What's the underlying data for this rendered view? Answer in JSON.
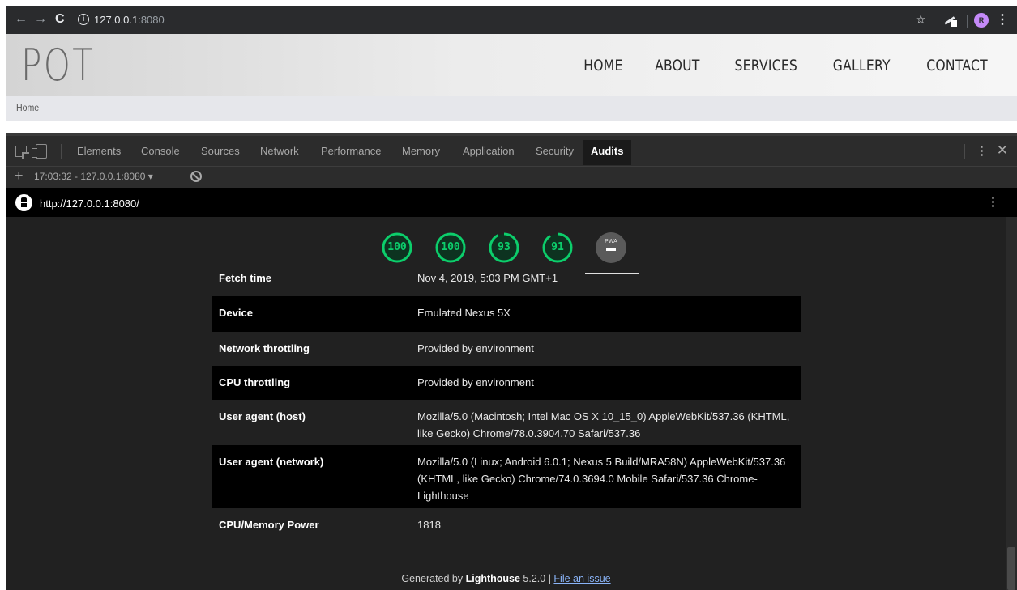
{
  "browser": {
    "nav": {
      "back": "←",
      "forward": "→",
      "reload": "C"
    },
    "url_host": "127.0.0.1",
    "url_port": ":8080",
    "avatar_letter": "R"
  },
  "site": {
    "logo": "POT",
    "nav": [
      "HOME",
      "ABOUT",
      "SERVICES",
      "GALLERY",
      "CONTACT"
    ],
    "breadcrumb": "Home"
  },
  "devtools": {
    "tabs": [
      "Elements",
      "Console",
      "Sources",
      "Network",
      "Performance",
      "Memory",
      "Application",
      "Security",
      "Audits"
    ],
    "active_tab": "Audits",
    "report_select": "17:03:32 - 127.0.0.1:8080 ▾"
  },
  "report": {
    "url": "http://127.0.0.1:8080/",
    "scores": [
      {
        "value": "100",
        "score": 100
      },
      {
        "value": "100",
        "score": 100
      },
      {
        "value": "93",
        "score": 93
      },
      {
        "value": "91",
        "score": 91
      }
    ],
    "pwa_label": "PWA",
    "score_color": "#0cce6b",
    "environment": [
      {
        "key": "Fetch time",
        "value": "Nov 4, 2019, 5:03 PM GMT+1"
      },
      {
        "key": "Device",
        "value": "Emulated Nexus 5X"
      },
      {
        "key": "Network throttling",
        "value": "Provided by environment"
      },
      {
        "key": "CPU throttling",
        "value": "Provided by environment"
      },
      {
        "key": "User agent (host)",
        "value": "Mozilla/5.0 (Macintosh; Intel Mac OS X 10_15_0) AppleWebKit/537.36 (KHTML, like Gecko) Chrome/78.0.3904.70 Safari/537.36"
      },
      {
        "key": "User agent (network)",
        "value": "Mozilla/5.0 (Linux; Android 6.0.1; Nexus 5 Build/MRA58N) AppleWebKit/537.36 (KHTML, like Gecko) Chrome/74.0.3694.0 Mobile Safari/537.36 Chrome-Lighthouse"
      },
      {
        "key": "CPU/Memory Power",
        "value": "1818"
      }
    ],
    "footer": {
      "prefix": "Generated by ",
      "tool": "Lighthouse",
      "version": " 5.2.0 | ",
      "link": "File an issue"
    }
  }
}
